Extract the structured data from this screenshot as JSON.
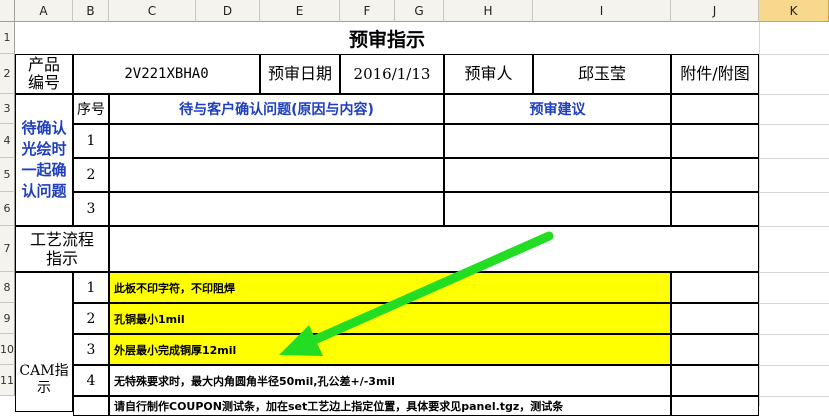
{
  "columns": [
    "A",
    "B",
    "C",
    "D",
    "E",
    "F",
    "G",
    "H",
    "I",
    "J",
    "K"
  ],
  "rows": [
    "1",
    "2",
    "3",
    "4",
    "5",
    "6",
    "7",
    "8",
    "9",
    "10",
    "11"
  ],
  "sheet": {
    "title": "预审指示",
    "product_no_label": "产品编号",
    "product_no_value": "2V221XBHA0",
    "review_date_label": "预审日期",
    "review_date_value": "2016/1/13",
    "reviewer_label": "预审人",
    "reviewer_value": "邱玉莹",
    "attachment_label": "附件/附图",
    "pending_label": "待确认光绘时一起确认问题",
    "seq_label": "序号",
    "issues_header": "待与客户确认问题(原因与内容)",
    "suggestion_header": "预审建议",
    "pending_rows": [
      "1",
      "2",
      "3"
    ],
    "process_label": "工艺流程指示",
    "cam_label": "CAM指示",
    "cam_items": [
      {
        "no": "1",
        "text": "此板不印字符，不印阻焊",
        "highlight": true
      },
      {
        "no": "2",
        "text": "孔铜最小1mil",
        "highlight": true
      },
      {
        "no": "3",
        "text": "外层最小完成铜厚12mil",
        "highlight": true
      },
      {
        "no": "4",
        "text": "无特殊要求时，最大内角圆角半径50mil,孔公差+/-3mil",
        "highlight": false
      },
      {
        "no": "",
        "text": "请自行制作COUPON测试条，加在set工艺边上指定位置，具体要求见panel.tgz，测试条",
        "highlight": false
      }
    ]
  },
  "arrow": {
    "color": "#22dd22"
  },
  "colors": {
    "highlight": "#ffff00",
    "blue_text": "#1f3fbf",
    "selected_header": "#f7d88c"
  }
}
